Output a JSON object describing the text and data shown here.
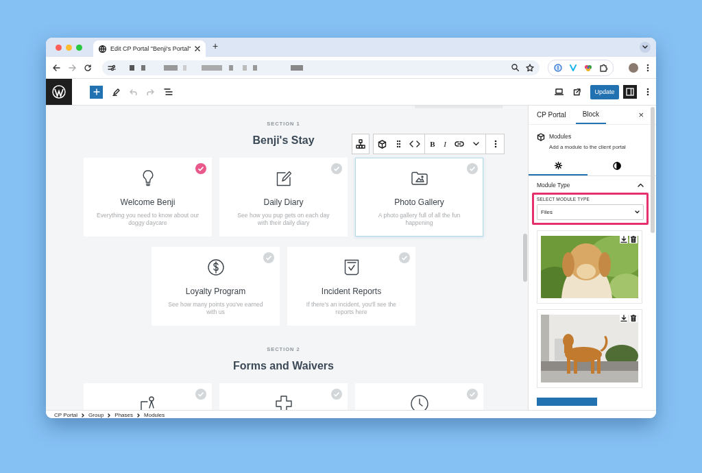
{
  "browser": {
    "tab_title": "Edit CP Portal \"Benji's Portal\"",
    "new_tab": "+"
  },
  "toolbar": {
    "update_button": "Update"
  },
  "block_toolbar": {
    "format_buttons": [
      "B",
      "I"
    ]
  },
  "sections": [
    {
      "label": "SECTION 1",
      "title": "Benji's Stay",
      "cards": [
        {
          "title": "Welcome Benji",
          "description": "Everything you need to know about our doggy daycare",
          "completed": true,
          "selected": false
        },
        {
          "title": "Daily Diary",
          "description": "See how you pup gets on each day with their daily diary",
          "completed": false,
          "selected": false
        },
        {
          "title": "Photo Gallery",
          "description": "A photo gallery full of all the fun happening",
          "completed": false,
          "selected": true
        },
        {
          "title": "Loyalty Program",
          "description": "See how many points you've earned with us",
          "completed": false,
          "selected": false
        },
        {
          "title": "Incident Reports",
          "description": "If there's an incident, you'll see the reports here",
          "completed": false,
          "selected": false
        }
      ]
    },
    {
      "label": "SECTION 2",
      "title": "Forms and Waivers",
      "cards": [
        {
          "completed": false,
          "selected": false
        },
        {
          "completed": false,
          "selected": false
        },
        {
          "completed": false,
          "selected": false
        }
      ]
    }
  ],
  "sidebar": {
    "tabs": [
      {
        "label": "CP Portal",
        "selected": false
      },
      {
        "label": "Block",
        "selected": true
      }
    ],
    "close": "×",
    "block": {
      "name": "Modules",
      "description": "Add a module to the client portal"
    },
    "subtabs": [
      {
        "selected": true
      },
      {
        "selected": false
      }
    ],
    "panel": {
      "title": "Module Type",
      "expanded": true,
      "field": {
        "label": "SELECT MODULE TYPE",
        "value": "Files",
        "highlighted": true
      }
    }
  },
  "breadcrumb": [
    "CP Portal",
    "Group",
    "Phases",
    "Modules"
  ]
}
